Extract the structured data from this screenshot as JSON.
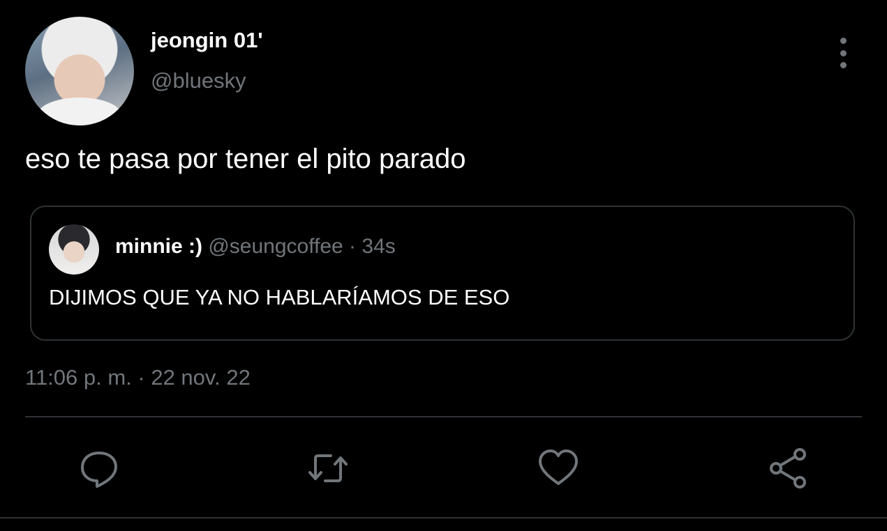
{
  "tweet": {
    "author": {
      "display_name": "jeongin 01'",
      "handle": "@bluesky"
    },
    "text": "eso te pasa por tener el pito parado",
    "timestamp": "11:06 p. m. · 22 nov. 22"
  },
  "quoted_tweet": {
    "display_name": "minnie :)",
    "meta": "@seungcoffee · 34s",
    "text": "DIJIMOS QUE YA NO HABLARÍAMOS DE ESO"
  },
  "actions": [
    {
      "icon": "reply-icon"
    },
    {
      "icon": "retweet-icon"
    },
    {
      "icon": "like-icon"
    },
    {
      "icon": "share-icon"
    }
  ],
  "colors": {
    "background": "#000000",
    "primary_text": "#ffffff",
    "secondary_text": "#71767b",
    "border": "#2f3336"
  }
}
